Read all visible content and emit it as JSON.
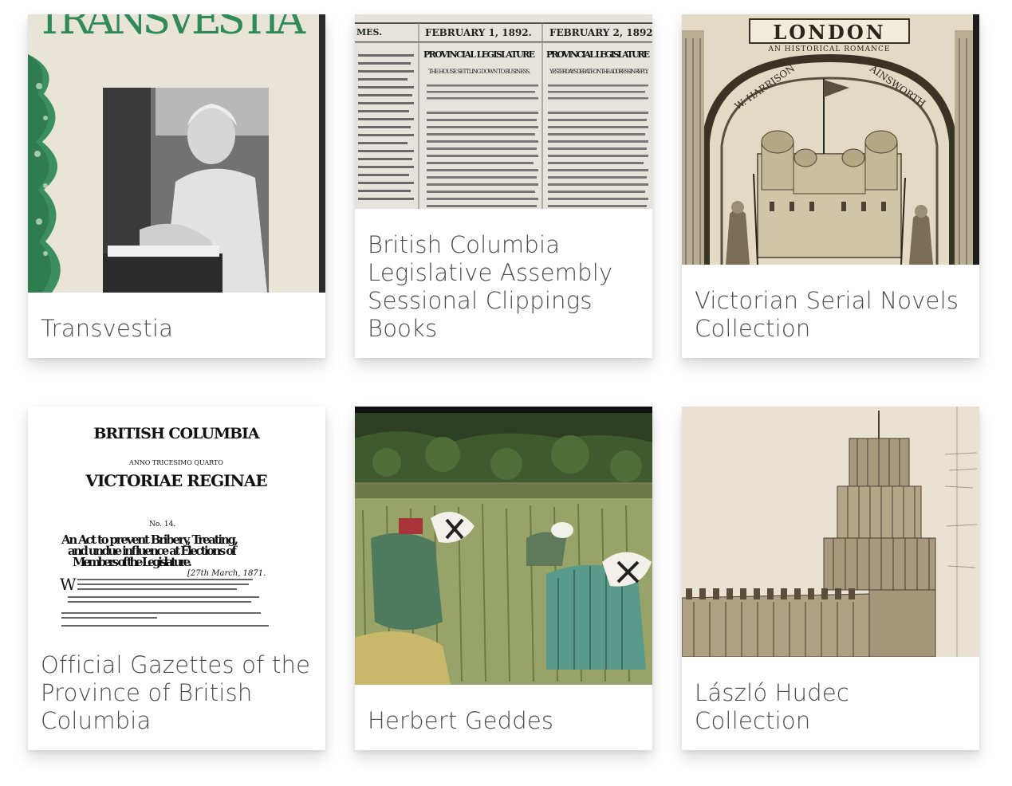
{
  "collections": [
    {
      "title": "Transvestia",
      "thumbnail": {
        "text": "TRANSVESTIA",
        "description": "magazine cover"
      }
    },
    {
      "title": "British Columbia Legislative Assembly Sessional Clippings Books",
      "thumbnail": {
        "date_left": "FEBRUARY 1, 1892.",
        "date_right": "FEBRUARY 2, 1892.",
        "masthead_fragment": "MES.",
        "headline_left": "PROVINCIAL LEGISLATURE",
        "headline_right": "PROVINCIAL LEGISLATURE",
        "sub_left": "THE HOUSE SETTLING DOWN TO BUSINESS.",
        "sub_right": "YESTERDAY'S DEBATE ON THE ADDRESS IN REPLY."
      }
    },
    {
      "title": "Victorian Serial Novels Collection",
      "thumbnail": {
        "banner": "LONDON",
        "subtitle": "AN HISTORICAL ROMANCE",
        "author_left": "W. HARRISON",
        "author_right": "AINSWORTH"
      }
    },
    {
      "title": "Official Gazettes of the Province of British Columbia",
      "thumbnail": {
        "heading": "BRITISH COLUMBIA",
        "anno": "ANNO TRICESIMO QUARTO",
        "reign": "VICTORIAE REGINAE",
        "number": "No. 14.",
        "act_line1": "An Act to prevent Bribery, Treating,",
        "act_line2": "and undue influence at Elections of",
        "act_line3": "Members of the Legislature.",
        "date": "[27th March, 1871."
      }
    },
    {
      "title": "Herbert Geddes",
      "thumbnail": {
        "description": "hand-coloured photograph of rice harvest"
      }
    },
    {
      "title": "László Hudec Collection",
      "thumbnail": {
        "description": "architectural sketch of a tower"
      }
    }
  ],
  "colors": {
    "caption": "#4a4a4a",
    "background": "#ffffff",
    "accent_green": "#2e8b57"
  }
}
